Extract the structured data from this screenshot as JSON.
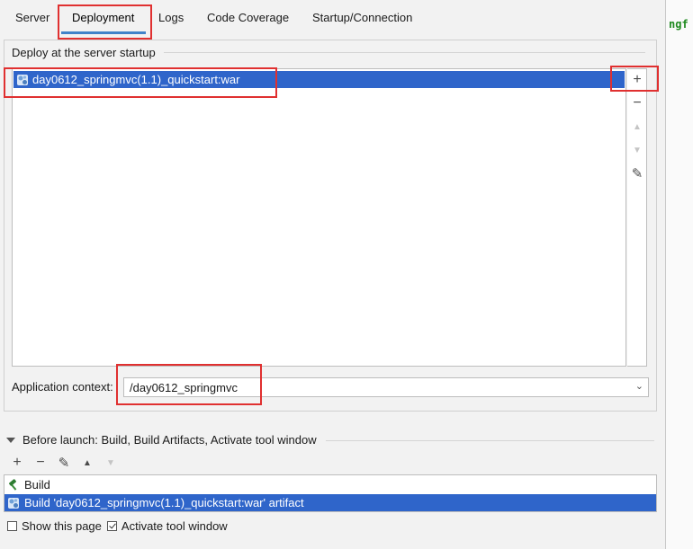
{
  "tabs": [
    {
      "label": "Server"
    },
    {
      "label": "Deployment"
    },
    {
      "label": "Logs"
    },
    {
      "label": "Code Coverage"
    },
    {
      "label": "Startup/Connection"
    }
  ],
  "active_tab": "Deployment",
  "right_strip_text": "ngf",
  "deploy": {
    "title": "Deploy at the server startup",
    "items": [
      {
        "label": "day0612_springmvc(1.1)_quickstart:war",
        "icon": "artifact-icon",
        "selected": true
      }
    ],
    "tools": {
      "add": "+",
      "remove": "−",
      "up": "▲",
      "down": "▼",
      "edit": "✎"
    }
  },
  "app_context": {
    "label": "Application context:",
    "value": "/day0612_springmvc"
  },
  "before_launch": {
    "title": "Before launch: Build, Build Artifacts, Activate tool window",
    "tools": {
      "add": "+",
      "remove": "−",
      "edit": "✎",
      "up": "▲",
      "down": "▼"
    },
    "items": [
      {
        "label": "Build",
        "icon": "hammer-icon",
        "selected": false
      },
      {
        "label": "Build 'day0612_springmvc(1.1)_quickstart:war' artifact",
        "icon": "artifact-icon",
        "selected": true
      }
    ]
  },
  "options": [
    {
      "label": "Show this page",
      "checked": false
    },
    {
      "label": "Activate tool window",
      "checked": true
    }
  ],
  "colors": {
    "selection": "#2f65ca",
    "tab_underline": "#4083c9",
    "highlight_box": "#e03030"
  }
}
